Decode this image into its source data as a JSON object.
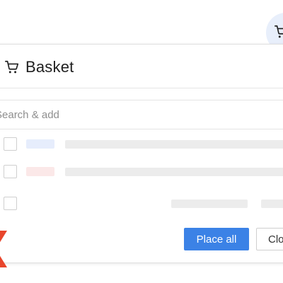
{
  "basket": {
    "title": "Basket",
    "search_placeholder": "Search & add",
    "items": [
      {
        "tag_color": "#e6edfc"
      },
      {
        "tag_color": "#fbe8e8"
      },
      {
        "tag_color": null
      }
    ],
    "place_all_label": "Place all",
    "close_label": "Clo"
  },
  "icons": {
    "header": "shopping-cart-icon",
    "fab": "shopping-cart-icon",
    "decor": "red-chevron-icon"
  },
  "colors": {
    "primary": "#3b82e6",
    "fab_bg": "#e8effb",
    "accent_red": "#e8452c"
  }
}
